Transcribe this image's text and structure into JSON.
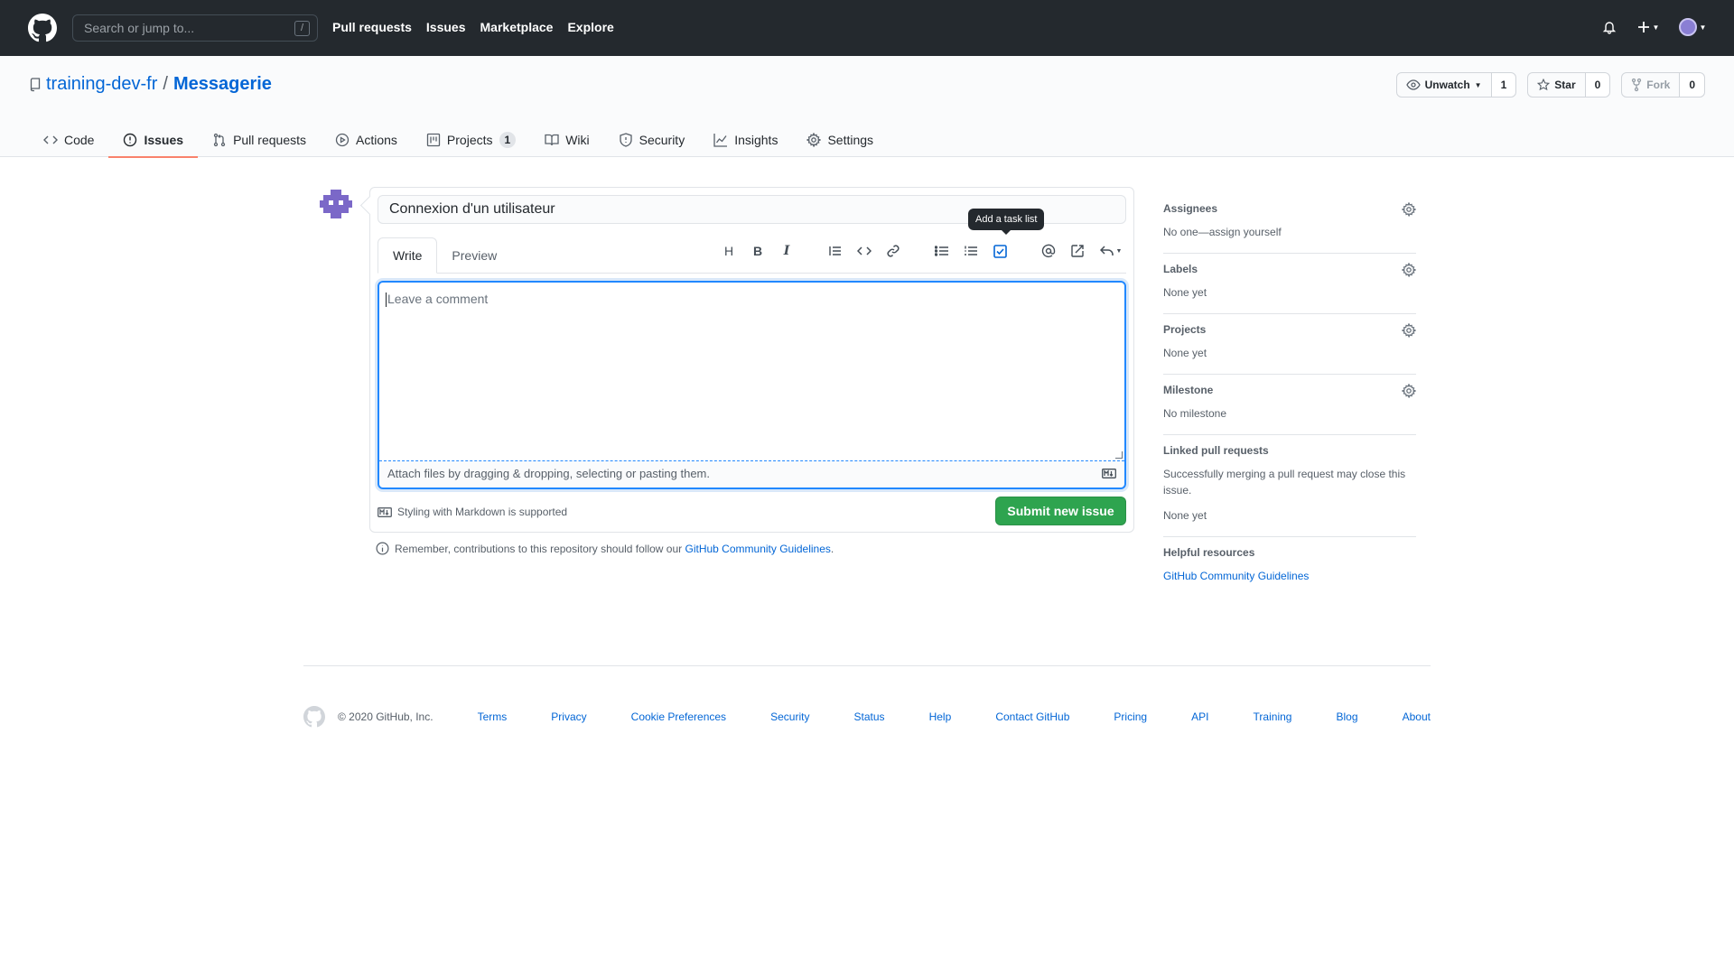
{
  "header": {
    "search_placeholder": "Search or jump to...",
    "slash_key": "/",
    "nav": [
      "Pull requests",
      "Issues",
      "Marketplace",
      "Explore"
    ]
  },
  "repo": {
    "owner": "training-dev-fr",
    "separator": "/",
    "name": "Messagerie",
    "unwatch_label": "Unwatch",
    "watch_count": "1",
    "star_label": "Star",
    "star_count": "0",
    "fork_label": "Fork",
    "fork_count": "0"
  },
  "tabs": [
    {
      "label": "Code",
      "icon": "code-icon"
    },
    {
      "label": "Issues",
      "icon": "issue-icon",
      "active": true
    },
    {
      "label": "Pull requests",
      "icon": "pull-request-icon"
    },
    {
      "label": "Actions",
      "icon": "play-icon"
    },
    {
      "label": "Projects",
      "icon": "project-icon",
      "counter": "1"
    },
    {
      "label": "Wiki",
      "icon": "book-icon"
    },
    {
      "label": "Security",
      "icon": "shield-icon"
    },
    {
      "label": "Insights",
      "icon": "graph-icon"
    },
    {
      "label": "Settings",
      "icon": "gear-icon"
    }
  ],
  "form": {
    "title_value": "Connexion d'un utilisateur",
    "write_tab": "Write",
    "preview_tab": "Preview",
    "tooltip": "Add a task list",
    "comment_placeholder": "Leave a comment",
    "attach_text": "Attach files by dragging & dropping, selecting or pasting them.",
    "markdown_note": "Styling with Markdown is supported",
    "submit_label": "Submit new issue",
    "remember_prefix": "Remember, contributions to this repository should follow our ",
    "remember_link": "GitHub Community Guidelines",
    "remember_suffix": "."
  },
  "sidebar": {
    "assignees": {
      "heading": "Assignees",
      "value": "No one—assign yourself"
    },
    "labels": {
      "heading": "Labels",
      "value": "None yet"
    },
    "projects": {
      "heading": "Projects",
      "value": "None yet"
    },
    "milestone": {
      "heading": "Milestone",
      "value": "No milestone"
    },
    "linked": {
      "heading": "Linked pull requests",
      "description": "Successfully merging a pull request may close this issue.",
      "value": "None yet"
    },
    "resources": {
      "heading": "Helpful resources",
      "link": "GitHub Community Guidelines"
    }
  },
  "footer": {
    "copyright": "© 2020 GitHub, Inc.",
    "links": [
      "Terms",
      "Privacy",
      "Cookie Preferences",
      "Security",
      "Status",
      "Help",
      "Contact GitHub",
      "Pricing",
      "API",
      "Training",
      "Blog",
      "About"
    ]
  },
  "colors": {
    "header_bg": "#24292e",
    "link": "#0366d6",
    "submit_green": "#2ea44f",
    "active_tab_underline": "#f9826c",
    "focus_blue": "#2188ff"
  }
}
